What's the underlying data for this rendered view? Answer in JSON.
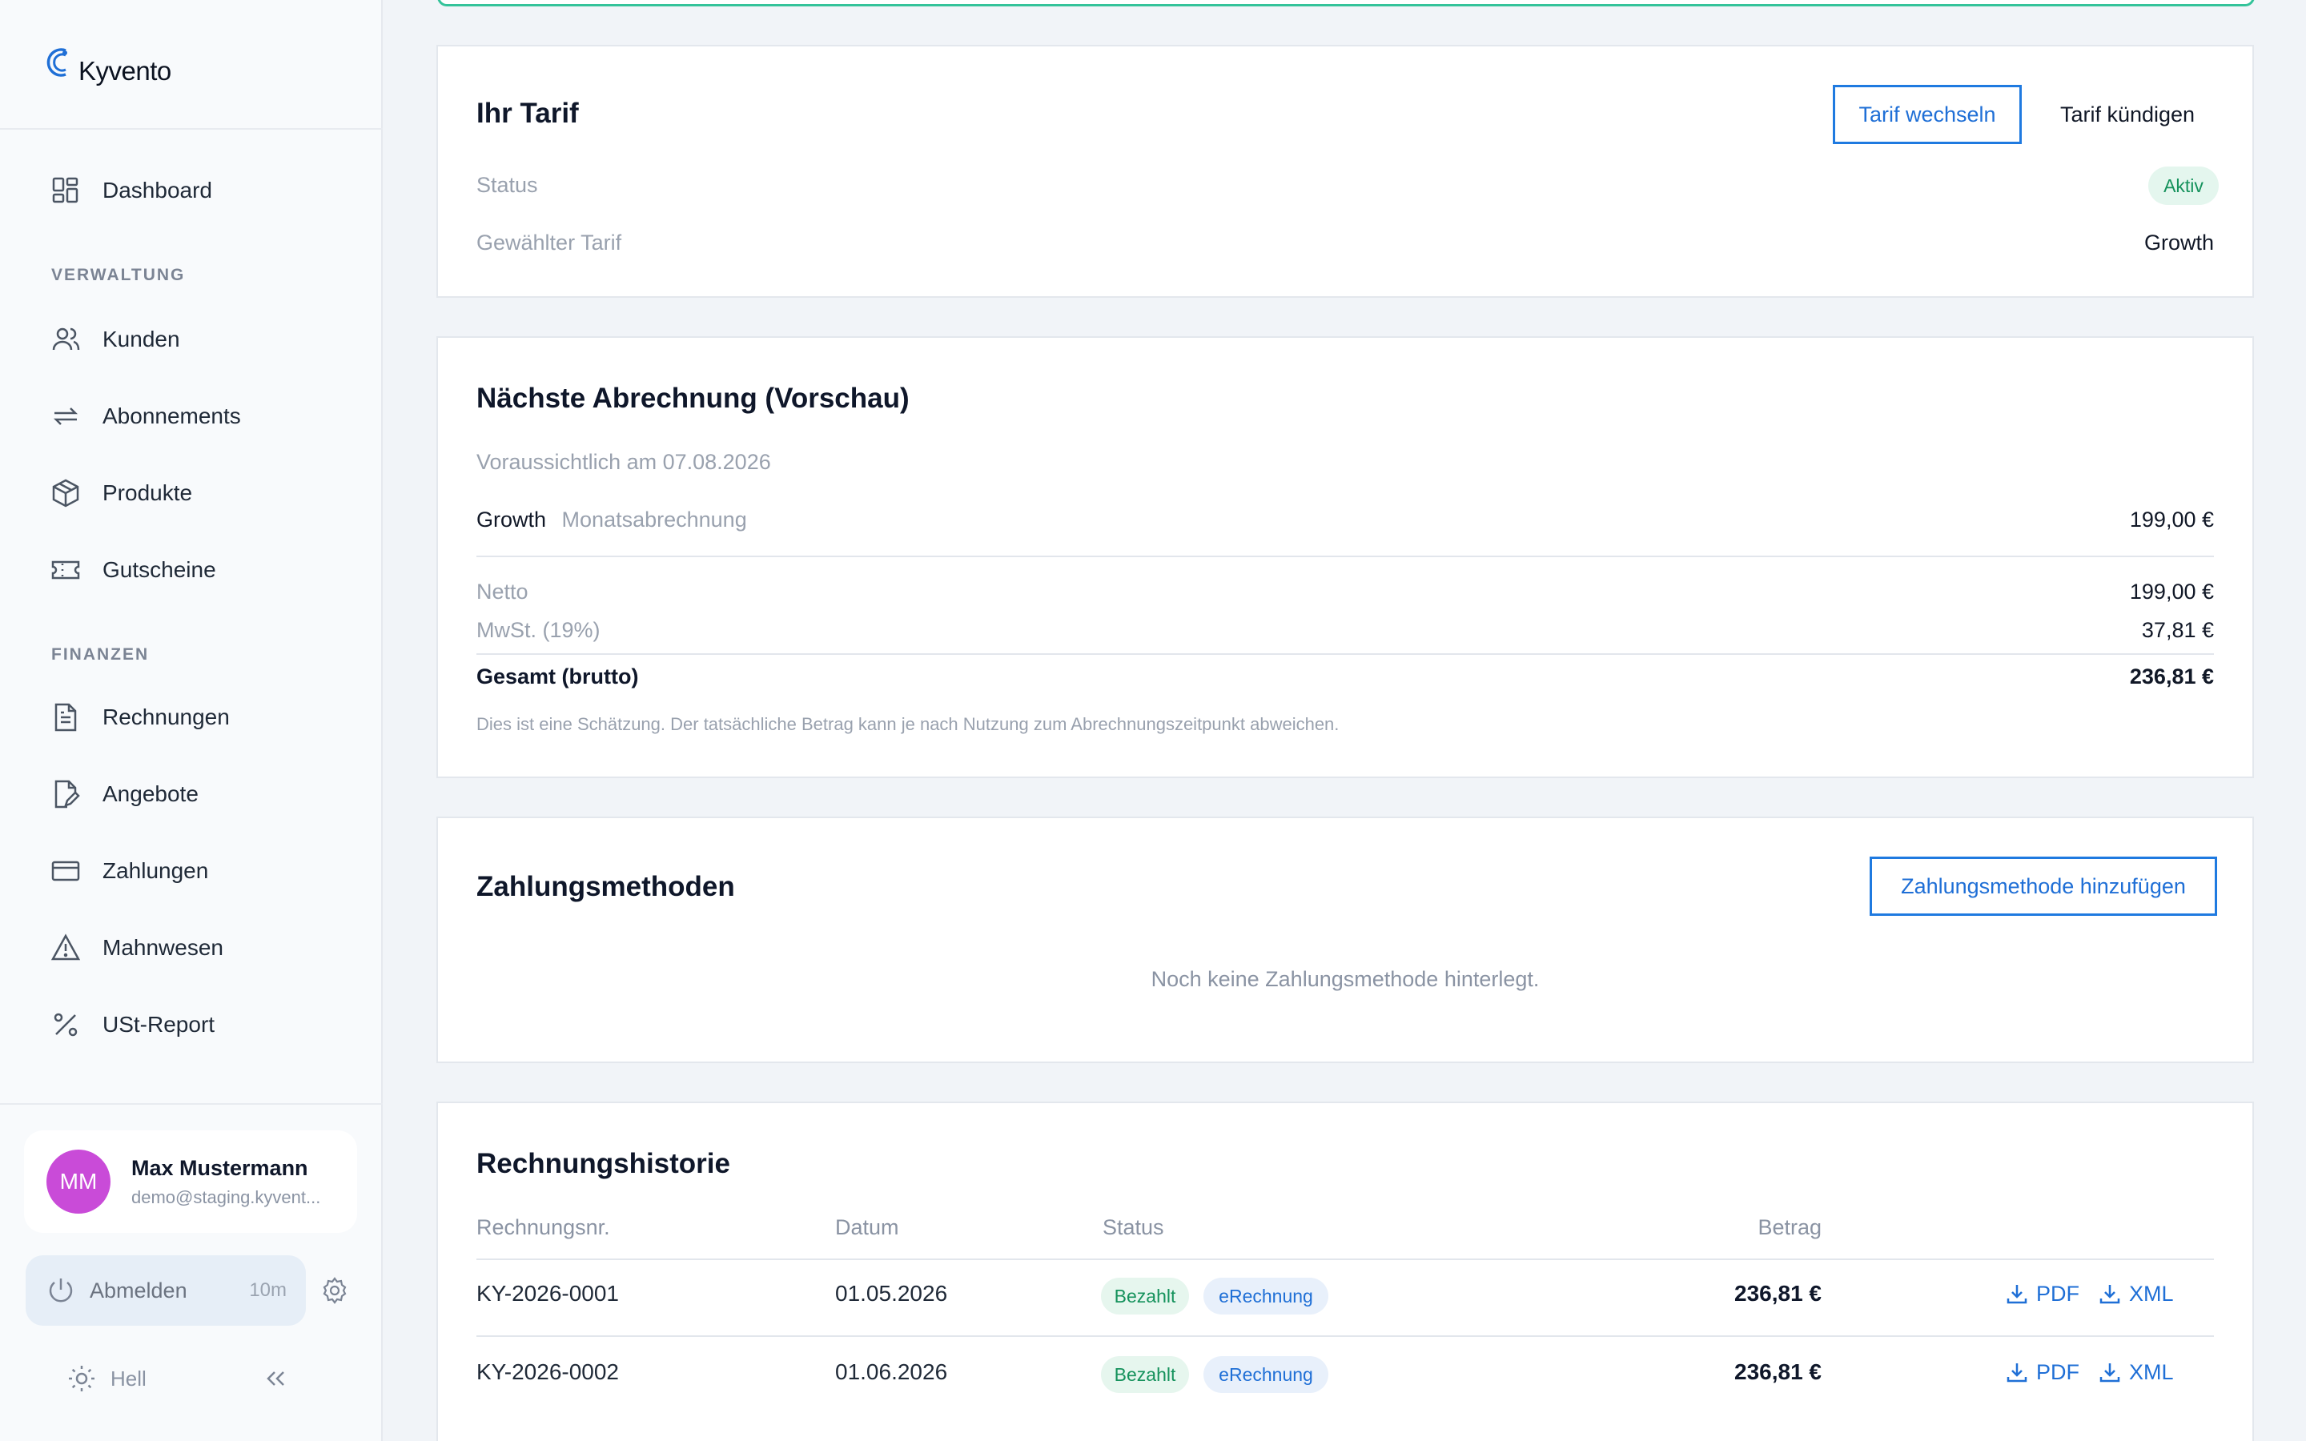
{
  "brand": {
    "name": "Kyvento"
  },
  "sidebar": {
    "dashboard": "Dashboard",
    "section_admin": "VERWALTUNG",
    "admin_items": [
      "Kunden",
      "Abonnements",
      "Produkte",
      "Gutscheine"
    ],
    "section_finance": "FINANZEN",
    "finance_items": [
      "Rechnungen",
      "Angebote",
      "Zahlungen",
      "Mahnwesen",
      "USt-Report"
    ],
    "user": {
      "initials": "MM",
      "name": "Max Mustermann",
      "email": "demo@staging.kyvent..."
    },
    "logout": {
      "label": "Abmelden",
      "timer": "10m"
    },
    "theme": {
      "label": "Hell"
    }
  },
  "tariff": {
    "title": "Ihr Tarif",
    "change_button": "Tarif wechseln",
    "cancel_button": "Tarif kündigen",
    "status_label": "Status",
    "status_value": "Aktiv",
    "plan_label": "Gewählter Tarif",
    "plan_value": "Growth"
  },
  "next_invoice": {
    "title": "Nächste Abrechnung (Vorschau)",
    "expected": "Voraussichtlich am 07.08.2026",
    "item_name": "Growth",
    "item_desc": "Monatsabrechnung",
    "item_amount": "199,00 €",
    "net_label": "Netto",
    "net_value": "199,00 €",
    "vat_label": "MwSt. (19%)",
    "vat_value": "37,81 €",
    "total_label": "Gesamt (brutto)",
    "total_value": "236,81 €",
    "note": "Dies ist eine Schätzung. Der tatsächliche Betrag kann je nach Nutzung zum Abrechnungszeitpunkt abweichen."
  },
  "payment_methods": {
    "title": "Zahlungsmethoden",
    "add_button": "Zahlungsmethode hinzufügen",
    "empty": "Noch keine Zahlungsmethode hinterlegt."
  },
  "history": {
    "title": "Rechnungshistorie",
    "columns": [
      "Rechnungsnr.",
      "Datum",
      "Status",
      "Betrag"
    ],
    "rows": [
      {
        "number": "KY-2026-0001",
        "date": "01.05.2026",
        "status": "Bezahlt",
        "tag": "eRechnung",
        "amount": "236,81 €",
        "pdf": "PDF",
        "xml": "XML"
      },
      {
        "number": "KY-2026-0002",
        "date": "01.06.2026",
        "status": "Bezahlt",
        "tag": "eRechnung",
        "amount": "236,81 €",
        "pdf": "PDF",
        "xml": "XML"
      }
    ]
  },
  "colors": {
    "accent": "#1f7ae0",
    "success": "#15925c",
    "avatar": "#c94bd8"
  }
}
